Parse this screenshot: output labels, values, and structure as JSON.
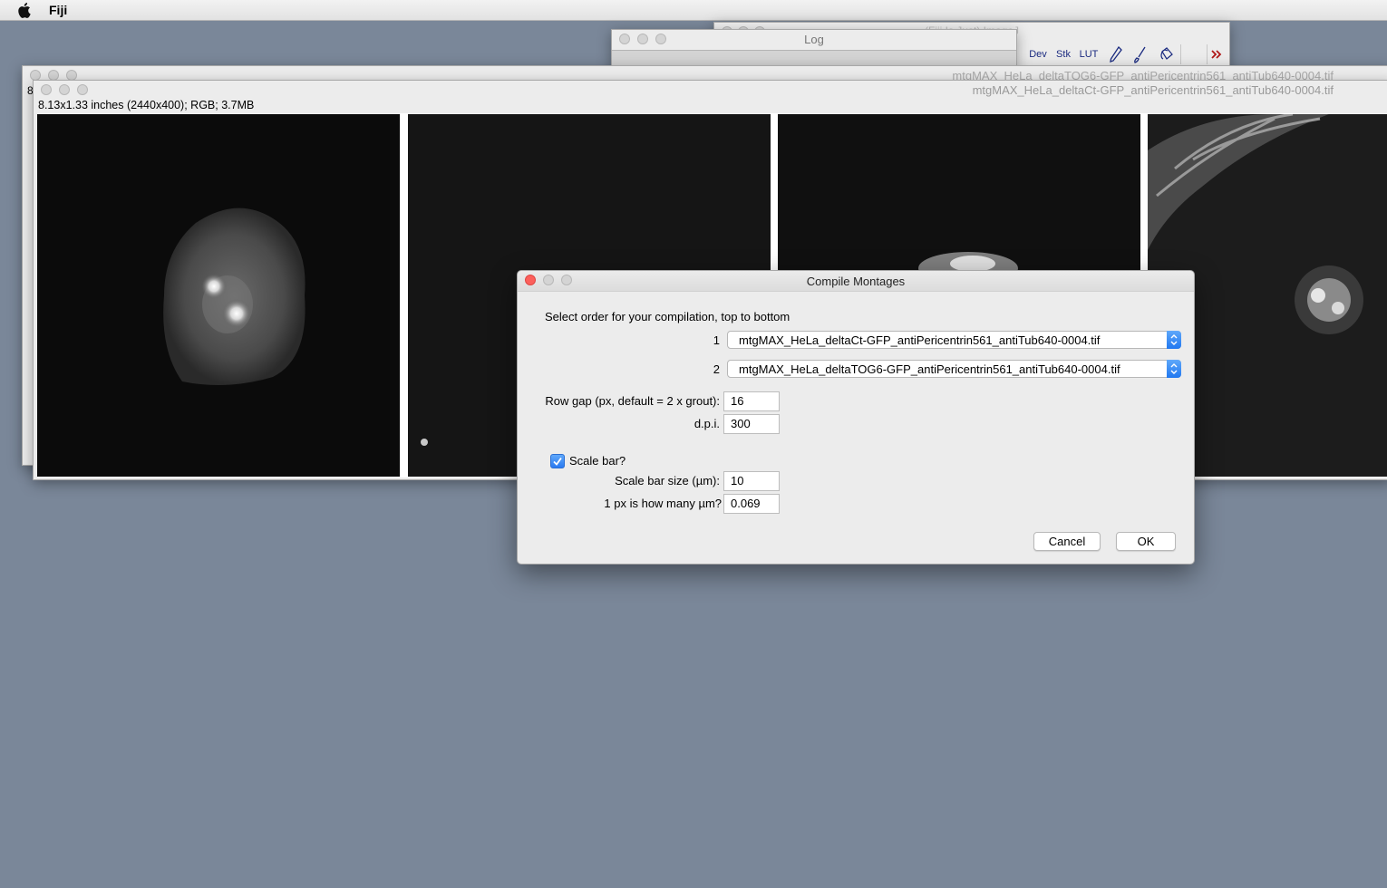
{
  "menubar": {
    "app_name": "Fiji"
  },
  "fiji_window": {
    "title": "(Fiji Is Just) ImageJ",
    "tools": [
      "Dev",
      "Stk",
      "LUT",
      "pencil-icon",
      "brush-icon",
      "flood-fill-icon",
      "",
      "more-tools-icon"
    ]
  },
  "log_window": {
    "title": "Log"
  },
  "image_window_back": {
    "title": "mtgMAX_HeLa_deltaTOG6-GFP_antiPericentrin561_antiTub640-0004.tif",
    "info_fragment": "8"
  },
  "image_window_front": {
    "title": "mtgMAX_HeLa_deltaCt-GFP_antiPericentrin561_antiTub640-0004.tif",
    "info": "8.13x1.33 inches (2440x400); RGB; 3.7MB"
  },
  "dialog": {
    "title": "Compile Montages",
    "instruction": "Select order for your compilation, top to bottom",
    "order_items": [
      {
        "index": "1",
        "value": "mtgMAX_HeLa_deltaCt-GFP_antiPericentrin561_antiTub640-0004.tif"
      },
      {
        "index": "2",
        "value": "mtgMAX_HeLa_deltaTOG6-GFP_antiPericentrin561_antiTub640-0004.tif"
      }
    ],
    "row_gap_label": "Row gap (px, default = 2 x grout):",
    "row_gap_value": "16",
    "dpi_label": "d.p.i.",
    "dpi_value": "300",
    "scale_bar_label": "Scale bar?",
    "scale_bar_checked": true,
    "scale_bar_size_label": "Scale bar size (µm):",
    "scale_bar_size_value": "10",
    "px_size_label": "1 px is how many µm?",
    "px_size_value": "0.069",
    "cancel_label": "Cancel",
    "ok_label": "OK"
  },
  "colors": {
    "desktop": "#7a8799",
    "close_button": "#fc605c",
    "accent_blue": "#2a7af1"
  }
}
